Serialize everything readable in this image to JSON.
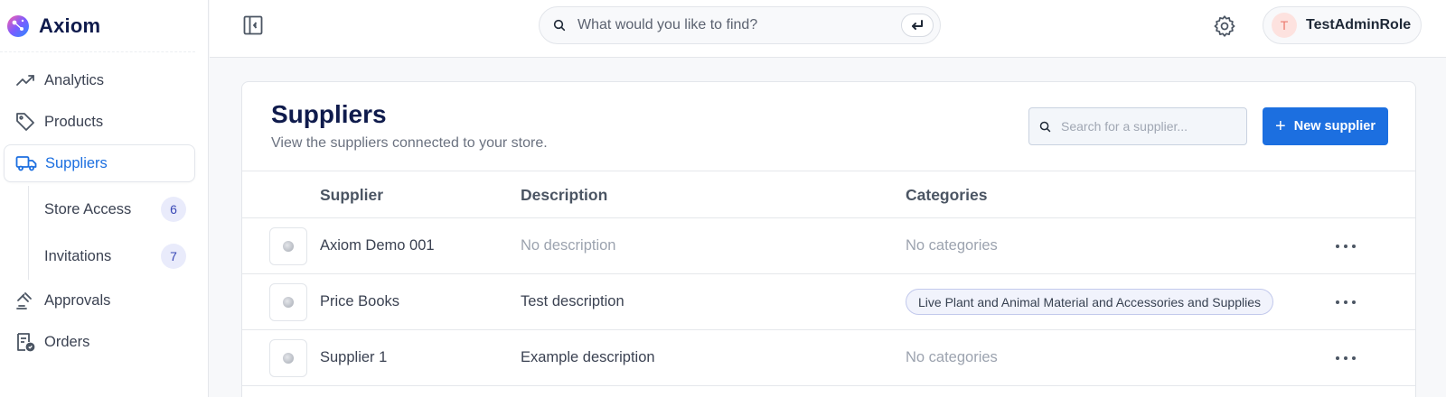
{
  "brand": {
    "name": "Axiom"
  },
  "sidebar": {
    "items": [
      {
        "label": "Analytics",
        "icon": "trend-line-icon"
      },
      {
        "label": "Products",
        "icon": "tag-icon"
      },
      {
        "label": "Suppliers",
        "icon": "truck-icon",
        "active": true
      },
      {
        "label": "Approvals",
        "icon": "gavel-icon"
      },
      {
        "label": "Orders",
        "icon": "receipt-check-icon"
      }
    ],
    "sub_items": [
      {
        "label": "Store Access",
        "count": "6"
      },
      {
        "label": "Invitations",
        "count": "7"
      }
    ]
  },
  "topbar": {
    "search_placeholder": "What would you like to find?",
    "user": {
      "initial": "T",
      "name": "TestAdminRole"
    }
  },
  "page": {
    "title": "Suppliers",
    "subtitle": "View the suppliers connected to your store.",
    "search_placeholder": "Search for a supplier...",
    "new_button_label": "New supplier"
  },
  "table": {
    "columns": [
      "Supplier",
      "Description",
      "Categories"
    ],
    "rows": [
      {
        "name": "Axiom Demo 001",
        "description": "No description",
        "categories": "No categories"
      },
      {
        "name": "Price Books",
        "description": "Test description",
        "categories": "Live Plant and Animal Material and Accessories and Supplies"
      },
      {
        "name": "Supplier 1",
        "description": "Example description",
        "categories": "No categories"
      }
    ]
  },
  "colors": {
    "accent": "#1c6fe0",
    "brand_text": "#0f1b4c",
    "badge_bg": "#e9ebfb",
    "tag_bg": "#f1f3fc"
  }
}
